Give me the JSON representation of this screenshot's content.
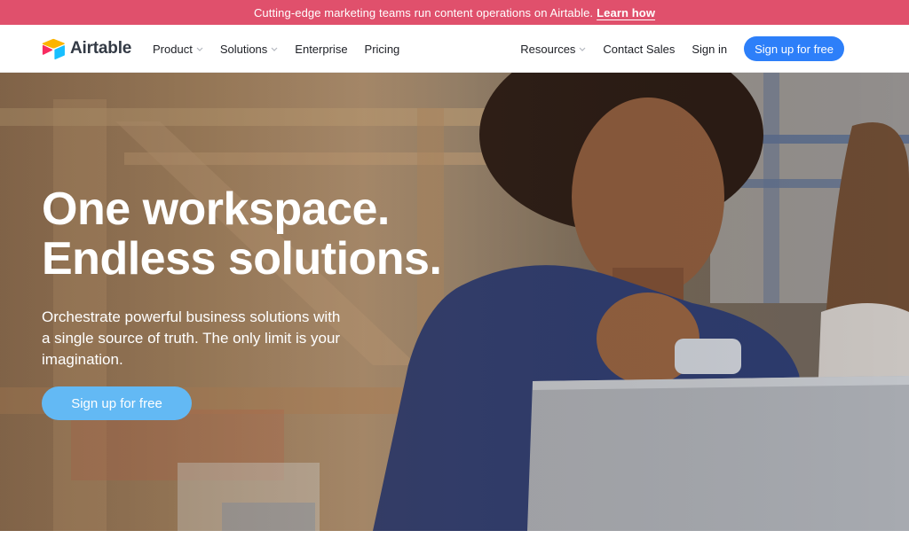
{
  "announcement": {
    "text": "Cutting-edge marketing teams run content operations on Airtable.",
    "link": "Learn how"
  },
  "nav": {
    "logo_text": "Airtable",
    "left_items": [
      "Product",
      "Solutions",
      "Enterprise",
      "Pricing"
    ],
    "right_items": [
      "Resources",
      "Contact Sales",
      "Sign in"
    ],
    "signup": "Sign up for free"
  },
  "hero": {
    "headline_line1": "One workspace.",
    "headline_line2": "Endless solutions.",
    "subhead": "Orchestrate powerful business solutions with a single source of truth. The only limit is your imagination.",
    "cta": "Sign up for free"
  },
  "colors": {
    "announcement_bg": "#e0506c",
    "primary_button": "#2d7ff9",
    "hero_button": "#63b9f4"
  },
  "icons": {
    "logo": "airtable-logo-icon",
    "dropdown": "chevron-down-icon"
  }
}
